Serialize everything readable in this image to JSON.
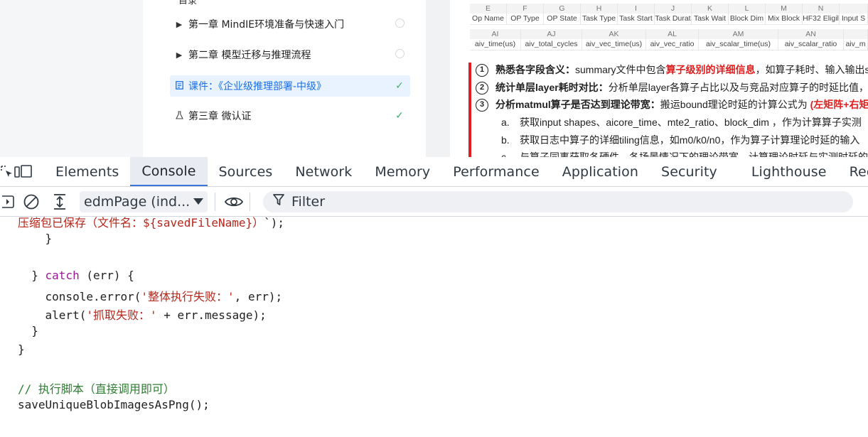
{
  "course_nav": {
    "cutoff_heading": "目录",
    "items": [
      {
        "label": "第一章 MindIE环境准备与快速入门",
        "status": "empty"
      },
      {
        "label": "第二章 模型迁移与推理流程",
        "status": "empty"
      },
      {
        "label": "课件：《企业级推理部署-中级》",
        "status": "done",
        "active": true
      },
      {
        "label": "第三章 微认证",
        "status": "done"
      }
    ]
  },
  "doc": {
    "sheet_row1_letters": [
      "E",
      "F",
      "G",
      "H",
      "I",
      "J",
      "K",
      "L",
      "M",
      "N",
      ""
    ],
    "sheet_row1_names": [
      "Op Name",
      "OP Type",
      "OP State",
      "Task Type",
      "Task Start",
      "Task Durat",
      "Task Wait",
      "Block Dim",
      "Mix Block",
      "HF32 Eligil",
      "Input S"
    ],
    "sheet_row2_letters": [
      "AI",
      "AJ",
      "AK",
      "AL",
      "AM",
      "AN",
      ""
    ],
    "sheet_row2_names": [
      "aiv_time(us)",
      "aiv_total_cycles",
      "aiv_vec_time(us)",
      "aiv_vec_ratio",
      "aiv_scalar_time(us)",
      "aiv_scalar_ratio",
      "aiv_m"
    ],
    "line1": {
      "num": "1",
      "bold": "熟悉各字段含义：",
      "plain1": "summary文件中包含",
      "red": "算子级别的详细信息",
      "plain2": "，如算子耗时、输入输出sh"
    },
    "line2": {
      "num": "2",
      "bold": "统计单层layer耗时对比：",
      "plain1": "分析单层layer各算子占比以及与竞品对应算子的时延比值，组"
    },
    "line3": {
      "num": "3",
      "bold": "分析matmul算子是否达到理论带宽：",
      "plain1": "搬运bound理论时延的计算公式为 ",
      "red": "(左矩阵+右矩"
    },
    "sub_a": {
      "mark": "a.",
      "text": "获取input shapes、aicore_time、mte2_ratio、block_dim ，作为计算算子实测"
    },
    "sub_b": {
      "mark": "b.",
      "plain1": "获取日志中算子的详细tiling信息，如",
      "red": "m0/k0/n0",
      "plain2": "，作为算子计算理论时延的输入"
    },
    "sub_c": {
      "mark": "c.",
      "plain1": "与算子同事获取各硬件，各场景情况下的理论带宽，",
      "red": "计算理论时延与实测时延的差"
    }
  },
  "devtools": {
    "tabs": [
      "Elements",
      "Console",
      "Sources",
      "Network",
      "Memory",
      "Performance",
      "Application",
      "Security",
      "Lighthouse",
      "Recorder"
    ],
    "active_tab": "Console",
    "context_label": "edmPage (ind...",
    "filter_placeholder": "Filter",
    "filter_label": "Filter"
  },
  "console": {
    "code": [
      {
        "parts": [
          [
            "str",
            "压缩包已保存（文件名：${savedFileName}）"
          ],
          [
            "plain",
            "`);"
          ]
        ]
      },
      {
        "parts": [
          [
            "plain",
            "    }"
          ]
        ]
      },
      {
        "parts": [
          [
            "plain",
            ""
          ]
        ]
      },
      {
        "parts": [
          [
            "plain",
            "  } "
          ],
          [
            "kw",
            "catch"
          ],
          [
            "plain",
            " (err) {"
          ]
        ]
      },
      {
        "parts": [
          [
            "plain",
            "    console.error("
          ],
          [
            "str",
            "'整体执行失败：'"
          ],
          [
            "plain",
            ", err);"
          ]
        ]
      },
      {
        "parts": [
          [
            "plain",
            "    alert("
          ],
          [
            "str",
            "'抓取失败：'"
          ],
          [
            "plain",
            " + err.message);"
          ]
        ]
      },
      {
        "parts": [
          [
            "plain",
            "  }"
          ]
        ]
      },
      {
        "parts": [
          [
            "plain",
            "}"
          ]
        ]
      },
      {
        "parts": [
          [
            "plain",
            ""
          ]
        ]
      },
      {
        "parts": [
          [
            "cmt",
            "// 执行脚本（直接调用即可）"
          ]
        ]
      },
      {
        "parts": [
          [
            "plain",
            "saveUniqueBlobImagesAsPng();"
          ]
        ]
      }
    ]
  },
  "colors": {
    "accent": "#1a6fe8",
    "check": "#3bb16a",
    "doc_red": "#e02020",
    "tab_active_underline": "#3c74d8"
  }
}
